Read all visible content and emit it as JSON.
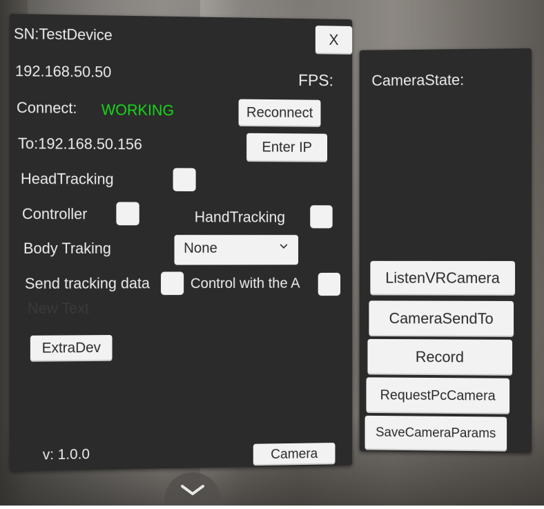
{
  "main": {
    "sn": "SN:TestDevice",
    "ip": "192.168.50.50",
    "fps_label": "FPS:",
    "connect_label": "Connect:",
    "connect_status": "WORKING",
    "to_ip": "To:192.168.50.156",
    "close_label": "X",
    "reconnect_label": "Reconnect",
    "enter_ip_label": "Enter IP",
    "head_tracking_label": "HeadTracking",
    "controller_label": "Controller",
    "hand_tracking_label": "HandTracking",
    "body_tracking_label": "Body Traking",
    "body_tracking_value": "None",
    "send_tracking_label": "Send tracking data",
    "control_with_label": "Control with the A",
    "placeholder_text": "New Text",
    "extradev_label": "ExtraDev",
    "version": "v: 1.0.0",
    "camera_label": "Camera"
  },
  "side": {
    "camera_state_label": "CameraState:",
    "buttons": [
      "ListenVRCamera",
      "CameraSendTo",
      "Record",
      "RequestPcCamera",
      "SaveCameraParams"
    ]
  },
  "colors": {
    "status_working": "#16d81a",
    "panel_bg": "#2b2b2b",
    "button_bg": "#f2f2f2"
  },
  "icons": {
    "dropdown": "chevron-down-icon",
    "fold": "chevron-down-icon"
  }
}
